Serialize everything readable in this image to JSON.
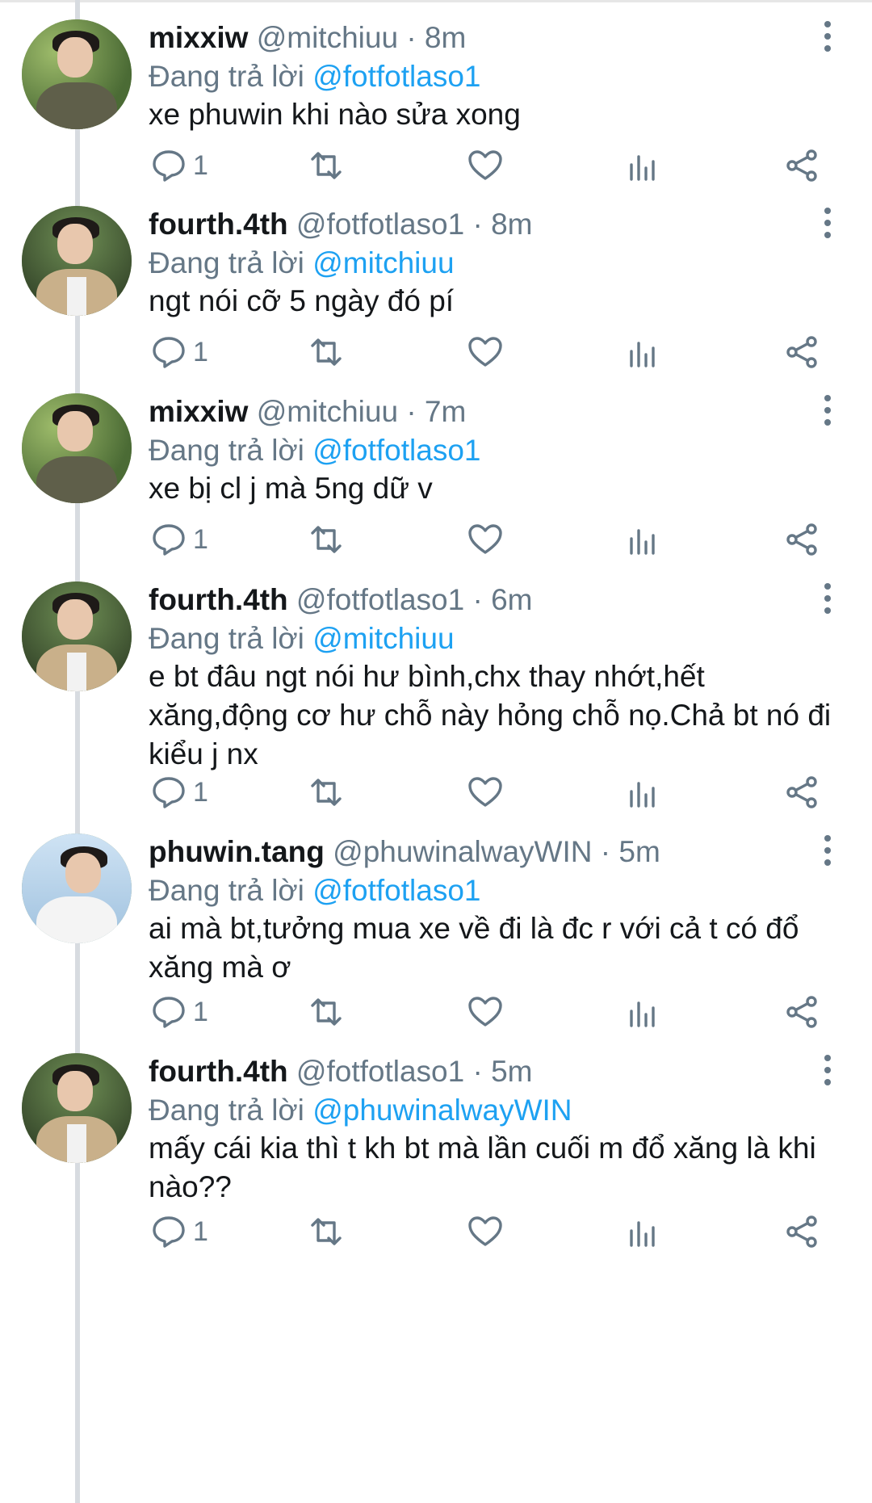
{
  "tweets": [
    {
      "author": "mixxiw",
      "handle": "@mitchiuu",
      "time": "8m",
      "reply_prefix": "Đang trả lời",
      "reply_to": "@fotfotlaso1",
      "text": "xe phuwin khi nào sửa xong",
      "reply_count": "1",
      "avatar": "mixxiw-avatar"
    },
    {
      "author": "fourth.4th",
      "handle": "@fotfotlaso1",
      "time": "8m",
      "reply_prefix": "Đang trả lời",
      "reply_to": "@mitchiuu",
      "text": "ngt nói cỡ 5 ngày đó pí",
      "reply_count": "1",
      "avatar": "fourth-avatar"
    },
    {
      "author": "mixxiw",
      "handle": "@mitchiuu",
      "time": "7m",
      "reply_prefix": "Đang trả lời",
      "reply_to": "@fotfotlaso1",
      "text": "xe bị cl j mà 5ng dữ v",
      "reply_count": "1",
      "avatar": "mixxiw-avatar"
    },
    {
      "author": "fourth.4th",
      "handle": "@fotfotlaso1",
      "time": "6m",
      "reply_prefix": "Đang trả lời",
      "reply_to": "@mitchiuu",
      "text": "e bt đâu ngt nói hư bình,chx thay nhớt,hết xăng,động cơ hư chỗ này hỏng chỗ nọ.Chả bt nó đi kiểu j nx",
      "reply_count": "1",
      "avatar": "fourth-avatar"
    },
    {
      "author": "phuwin.tang",
      "handle": "@phuwinalwayWIN",
      "time": "5m",
      "reply_prefix": "Đang trả lời",
      "reply_to": "@fotfotlaso1",
      "text": "ai mà bt,tưởng mua xe về đi là đc r với cả t có đổ xăng mà ơ",
      "reply_count": "1",
      "avatar": "phuwin-avatar"
    },
    {
      "author": "fourth.4th",
      "handle": "@fotfotlaso1",
      "time": "5m",
      "reply_prefix": "Đang trả lời",
      "reply_to": "@phuwinalwayWIN",
      "text": "mấy cái kia thì t kh bt mà lần cuối m đổ xăng là khi nào??",
      "reply_count": "1",
      "avatar": "fourth-avatar"
    }
  ],
  "icons": {
    "reply": "comment-icon",
    "retweet": "retweet-icon",
    "like": "heart-icon",
    "stats": "bar-chart-icon",
    "share": "share-icon",
    "more": "more-vertical-icon"
  },
  "colors": {
    "link": "#1da1f2",
    "muted": "#657786",
    "text": "#14171a",
    "thread": "#d7dbe0"
  }
}
